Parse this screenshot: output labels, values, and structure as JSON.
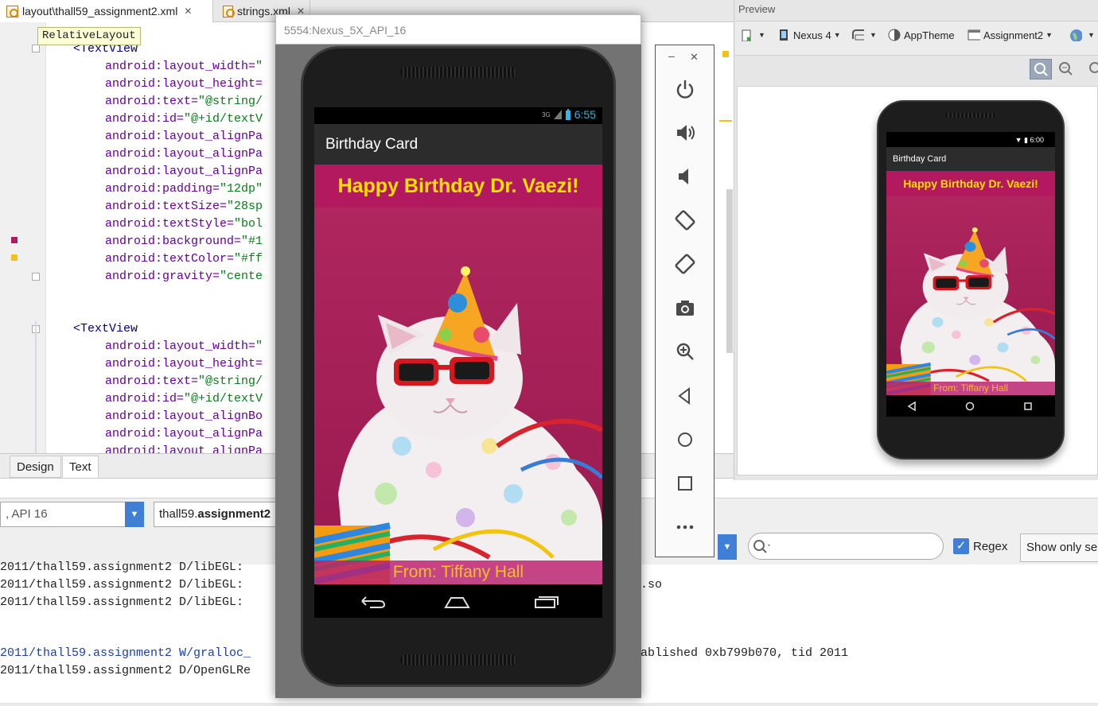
{
  "tabs": [
    {
      "label": "layout\\thall59_assignment2.xml",
      "close": "✕"
    },
    {
      "label": "strings.xml",
      "close": "✕"
    }
  ],
  "tooltip": "RelativeLayout",
  "code": {
    "block1": [
      {
        "name": "<TextView",
        "value": ""
      },
      {
        "name": "android:layout_width=",
        "value": "\""
      },
      {
        "name": "android:layout_height=",
        "value": ""
      },
      {
        "name": "android:text=",
        "value": "\"@string/"
      },
      {
        "name": "android:id=",
        "value": "\"@+id/textV"
      },
      {
        "name": "android:layout_alignPa",
        "value": ""
      },
      {
        "name": "android:layout_alignPa",
        "value": ""
      },
      {
        "name": "android:layout_alignPa",
        "value": ""
      },
      {
        "name": "android:padding=",
        "value": "\"12dp\""
      },
      {
        "name": "android:textSize=",
        "value": "\"28sp"
      },
      {
        "name": "android:textStyle=",
        "value": "\"bol"
      },
      {
        "name": "android:background=",
        "value": "\"#1"
      },
      {
        "name": "android:textColor=",
        "value": "\"#ff"
      },
      {
        "name": "android:gravity=",
        "value": "\"cente"
      }
    ],
    "block2": [
      {
        "name": "<TextView",
        "value": ""
      },
      {
        "name": "android:layout_width=",
        "value": "\""
      },
      {
        "name": "android:layout_height=",
        "value": ""
      },
      {
        "name": "android:text=",
        "value": "\"@string/"
      },
      {
        "name": "android:id=",
        "value": "\"@+id/textV"
      },
      {
        "name": "android:layout_alignBo",
        "value": ""
      },
      {
        "name": "android:layout_alignPa",
        "value": ""
      },
      {
        "name": "android:layout_alignPa",
        "value": ""
      }
    ]
  },
  "editor_tabs": {
    "design": "Design",
    "text": "Text"
  },
  "logcat": {
    "device": ", API 16",
    "package_prefix": "thall59.",
    "package_bold": "assignment2",
    "search_placeholder": "",
    "regex_label": "Regex",
    "regex_checked": true,
    "show_only": "Show only sel",
    "lines": [
      {
        "text": "2011/thall59.assignment2 D/libEGL:",
        "level": "D"
      },
      {
        "text": "2011/thall59.assignment2 D/libEGL:",
        "level": "D",
        "tail": ".so"
      },
      {
        "text": "2011/thall59.assignment2 D/libEGL:",
        "level": "D"
      },
      {
        "text": "2011/thall59.assignment2 W/gralloc_",
        "level": "W",
        "tail": "ablished 0xb799b070, tid 2011"
      },
      {
        "text": "2011/thall59.assignment2 D/OpenGLRe",
        "level": "D"
      }
    ]
  },
  "preview": {
    "title": "Preview",
    "device": "Nexus 4",
    "theme": "AppTheme",
    "activity": "Assignment2",
    "phone": {
      "time": "6:00",
      "app_title": "Birthday Card",
      "banner": "Happy Birthday Dr. Vaezi!",
      "footer": "From: Tiffany Hall"
    }
  },
  "emulator": {
    "title": "5554:Nexus_5X_API_16",
    "status_time": "6:55",
    "network": "3G",
    "app_title": "Birthday Card",
    "banner": "Happy Birthday Dr. Vaezi!",
    "footer": "From: Tiffany Hall"
  },
  "emulator_controls": {
    "minimize": "–",
    "close": "✕",
    "buttons": [
      "power-icon",
      "volume-up-icon",
      "volume-down-icon",
      "rotate-left-icon",
      "rotate-right-icon",
      "camera-icon",
      "zoom-icon",
      "back-icon",
      "home-icon",
      "overview-icon",
      "more-icon"
    ]
  },
  "colors": {
    "banner_bg": "#b3195f",
    "banner_text": "#ffe000",
    "footer_text": "#f4c020",
    "accent": "#3f7fd6"
  }
}
